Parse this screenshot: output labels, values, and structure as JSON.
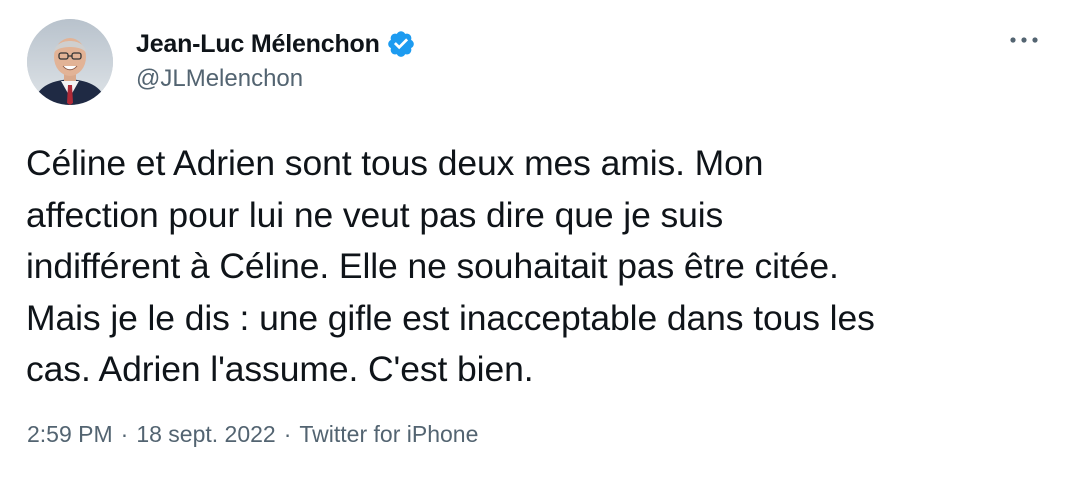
{
  "author": {
    "display_name": "Jean-Luc Mélenchon",
    "handle": "@JLMelenchon",
    "verified": true
  },
  "tweet": {
    "text": "Céline et Adrien sont tous deux mes amis. Mon\naffection pour lui ne veut pas dire que je suis\nindifférent à Céline. Elle ne souhaitait pas être citée.\nMais je le dis : une gifle est inacceptable dans tous les\ncas. Adrien l'assume. C'est bien.",
    "time": "2:59 PM",
    "separator": "·",
    "date": "18 sept. 2022",
    "source": "Twitter for iPhone"
  },
  "icons": {
    "verified": "verified-badge-icon",
    "more": "more-options-icon"
  },
  "colors": {
    "text": "#0f1419",
    "secondary": "#536471",
    "verified_blue": "#1d9bf0",
    "background": "#ffffff"
  }
}
